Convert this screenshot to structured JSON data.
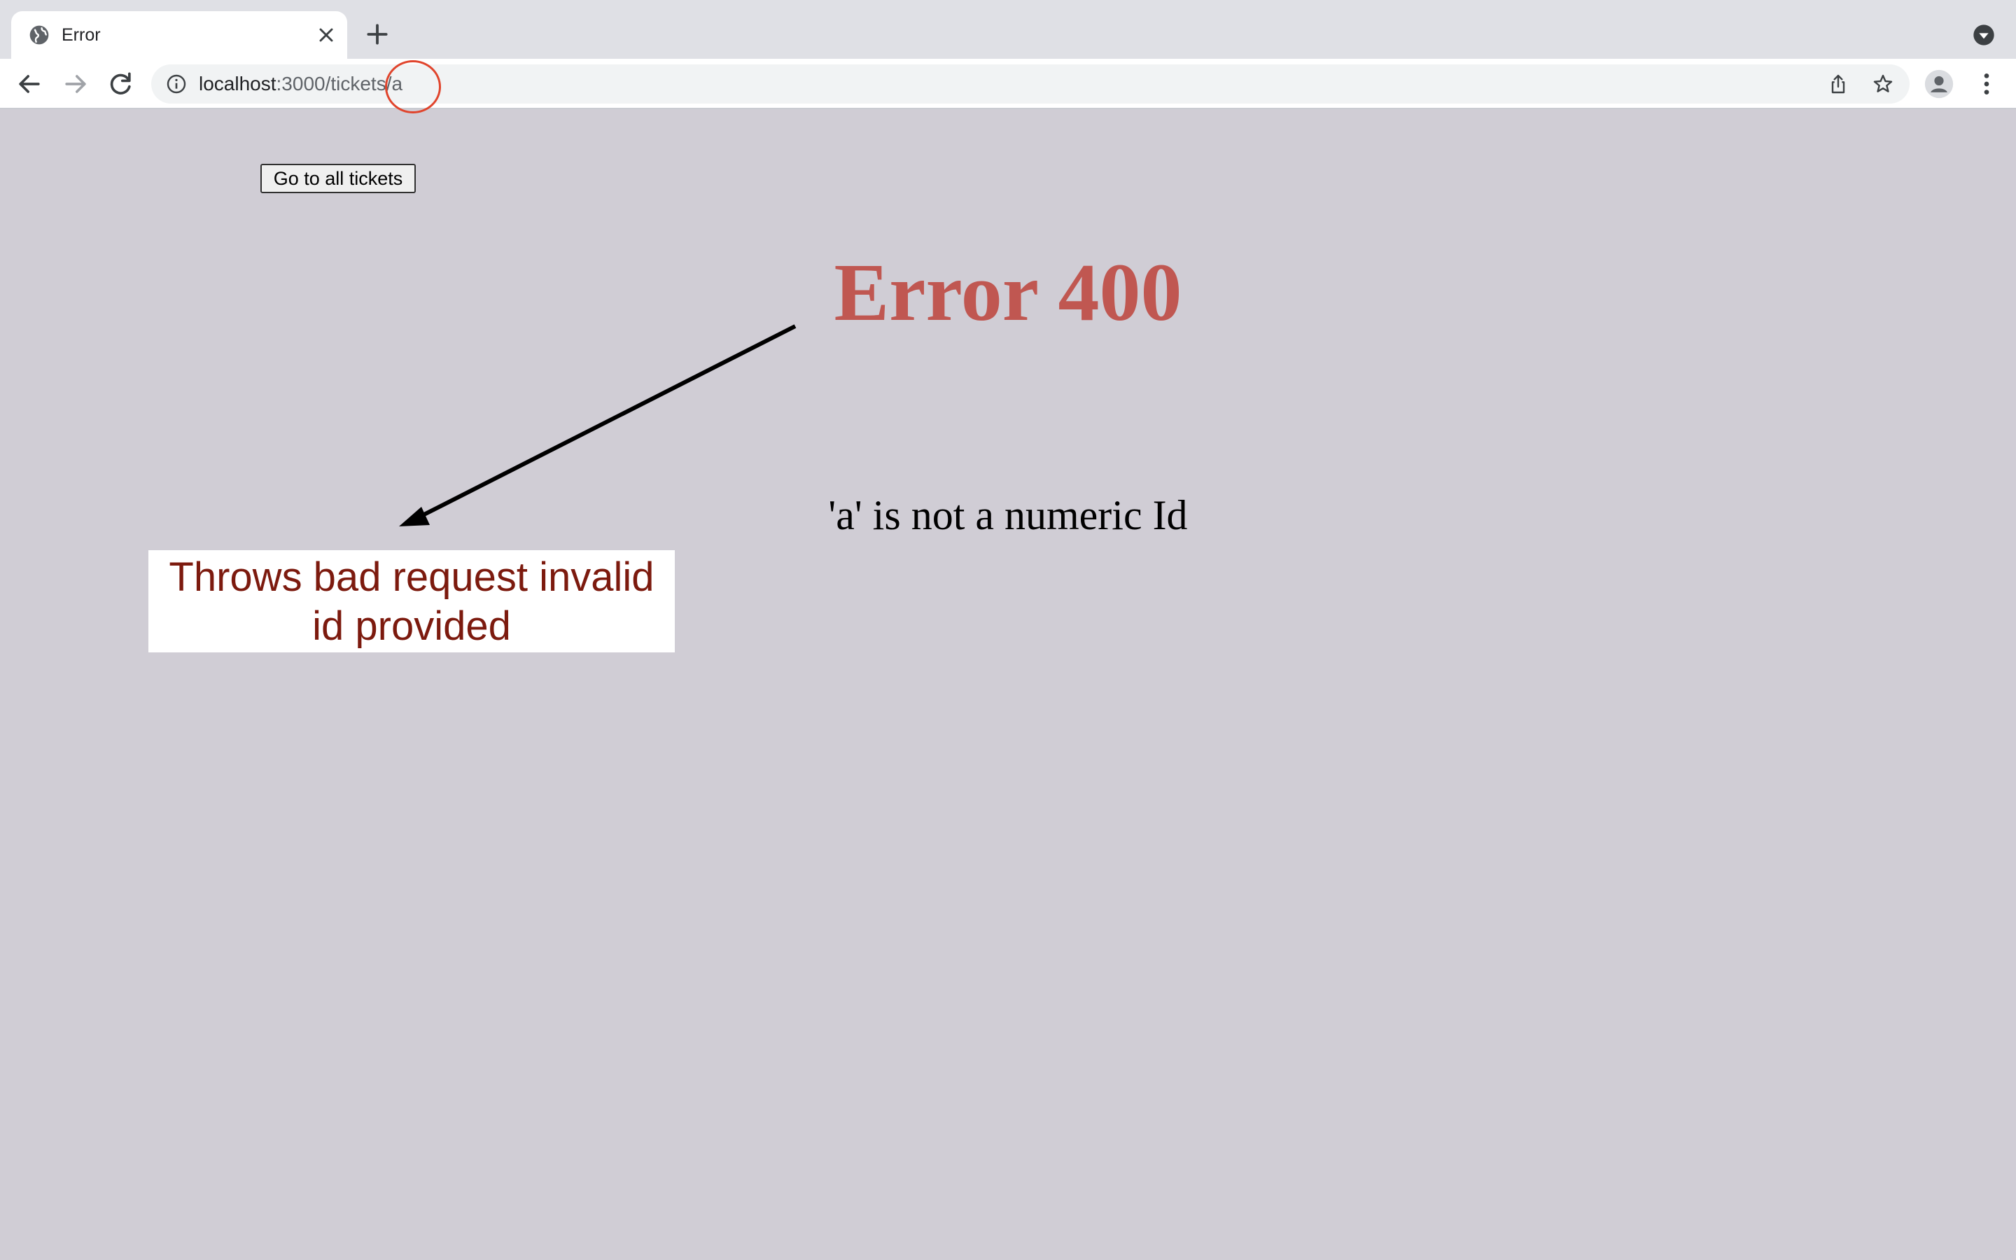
{
  "browser": {
    "tab": {
      "title": "Error"
    },
    "address": {
      "host": "localhost",
      "rest": ":3000/tickets/a"
    }
  },
  "page": {
    "back_button_label": "Go to all tickets",
    "error_title": "Error 400",
    "error_message": "'a' is not a numeric Id"
  },
  "annotation": {
    "callout_text": "Throws bad request invalid id provided",
    "circle_color": "#e0442c",
    "callout_text_color": "#7c1a0e",
    "title_color": "#c05751"
  }
}
